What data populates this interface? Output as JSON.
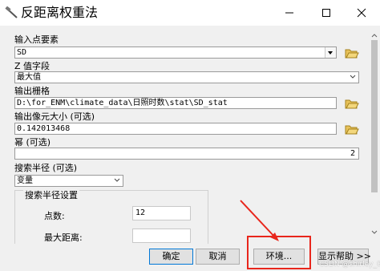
{
  "window": {
    "title": "反距离权重法"
  },
  "form": {
    "input_points": {
      "label": "输入点要素",
      "value": "SD"
    },
    "z_field": {
      "label": "Z 值字段",
      "value": "最大值"
    },
    "output_raster": {
      "label": "输出栅格",
      "value": "D:\\for_ENM\\climate_data\\日照时数\\stat\\SD_stat"
    },
    "cell_size": {
      "label": "输出像元大小 (可选)",
      "value": "0.142013468"
    },
    "power": {
      "label": "幂 (可选)",
      "value": "2"
    },
    "search_radius": {
      "label": "搜索半径 (可选)",
      "value": "变量"
    },
    "search_radius_settings": {
      "title": "搜索半径设置",
      "point_count_label": "点数:",
      "point_count_value": "12",
      "max_distance_label": "最大距离:",
      "max_distance_value": ""
    }
  },
  "buttons": {
    "ok": "确定",
    "cancel": "取消",
    "environments": "环境...",
    "show_help": "显示帮助 >>"
  },
  "watermark": "CSDN @shirley_0917",
  "colors": {
    "annotation": "#e8261c",
    "focus_border": "#0078d7"
  }
}
